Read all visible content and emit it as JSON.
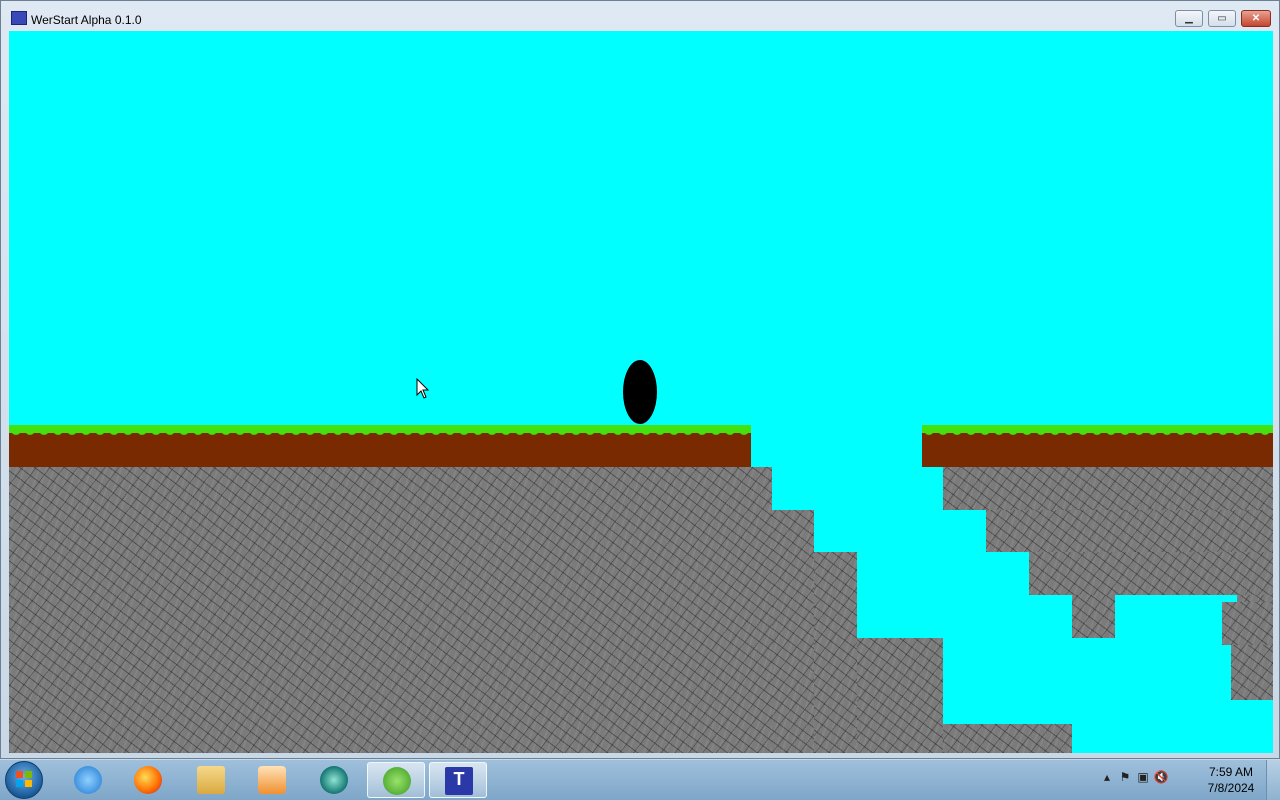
{
  "window": {
    "title": "WerStart Alpha 0.1.0",
    "icon": "app-icon",
    "controls": {
      "minimize": "minimize-icon",
      "maximize": "maximize-icon",
      "close": "close-icon"
    }
  },
  "game": {
    "sky_color": "#00ffff",
    "grass_color": "#44e010",
    "dirt_color": "#7a2a00",
    "rock_color": "#7b7b7b",
    "player_color": "#000000"
  },
  "taskbar": {
    "apps": [
      {
        "name": "Internet Explorer",
        "icon": "internet-explorer-icon"
      },
      {
        "name": "Firefox",
        "icon": "firefox-icon"
      },
      {
        "name": "File Explorer",
        "icon": "folder-icon"
      },
      {
        "name": "Media Player",
        "icon": "media-player-icon"
      },
      {
        "name": "Camo",
        "icon": "camo-icon"
      },
      {
        "name": "uTorrent",
        "icon": "utorrent-icon"
      },
      {
        "name": "T game",
        "icon": "t-game-icon"
      }
    ],
    "clock": {
      "time": "7:59 AM",
      "date": "7/8/2024"
    }
  }
}
